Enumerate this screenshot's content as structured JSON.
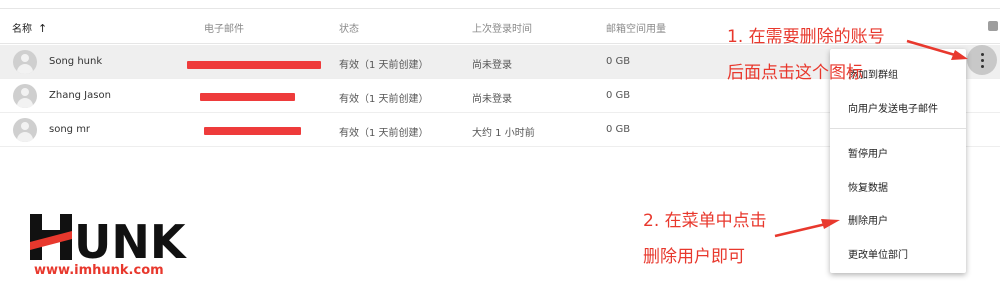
{
  "table": {
    "headers": {
      "name": "名称",
      "email": "电子邮件",
      "status": "状态",
      "last_login": "上次登录时间",
      "storage": "邮箱空间用量"
    },
    "sort_icon": "arrow-up-icon",
    "rows": [
      {
        "name": "Song hunk",
        "status": "有效（1 天前创建）",
        "last_login": "尚未登录",
        "storage": "0 GB"
      },
      {
        "name": "Zhang Jason",
        "status": "有效（1 天前创建）",
        "last_login": "尚未登录",
        "storage": "0 GB"
      },
      {
        "name": "song mr",
        "status": "有效（1 天前创建）",
        "last_login": "大约 1 小时前",
        "storage": "0 GB"
      }
    ]
  },
  "more_button_icon": "more-vert-icon",
  "menu": {
    "items": [
      {
        "label": "添加到群组"
      },
      {
        "label": "向用户发送电子邮件"
      },
      {
        "label": "暂停用户"
      },
      {
        "label": "恢复数据"
      },
      {
        "label": "删除用户"
      },
      {
        "label": "更改单位部门"
      }
    ]
  },
  "annotations": {
    "step1_line1": "1. 在需要删除的账号",
    "step1_line2": "后面点击这个图标",
    "step2_line1": "2. 在菜单中点击",
    "step2_line2": "删除用户即可"
  },
  "logo": {
    "text": "HUNK",
    "url": "www.imhunk.com"
  },
  "colors": {
    "annotation_red": "#e8382d",
    "redaction_red": "#ee3b3b",
    "logo_black": "#111111"
  }
}
